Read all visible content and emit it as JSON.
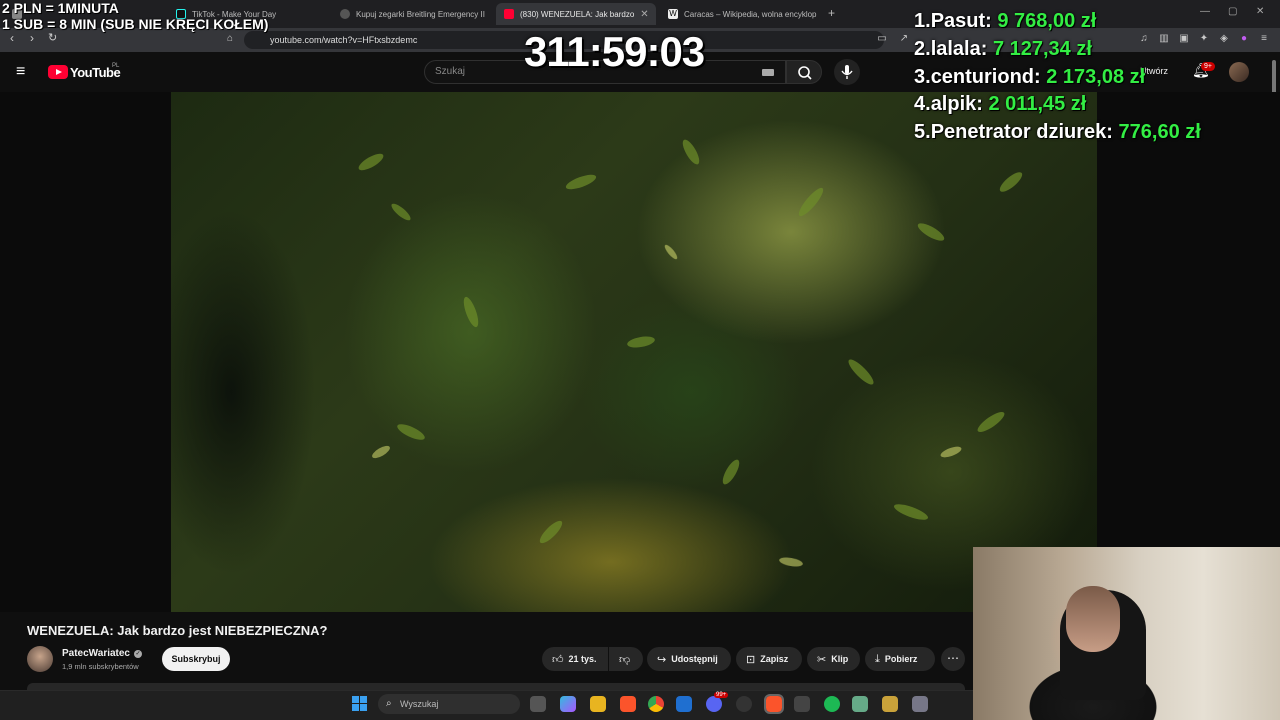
{
  "browser": {
    "tabs": [
      {
        "label": "",
        "icon": "tab-icon"
      },
      {
        "label": "TikTok - Make Your Day",
        "icon": "tiktok-icon"
      },
      {
        "label": "Kupuj zegarki Breitling Emergency II",
        "icon": "globe-icon"
      },
      {
        "label": "(830) WENEZUELA: Jak bardzo",
        "icon": "youtube-icon"
      },
      {
        "label": "Caracas – Wikipedia, wolna encyklop",
        "icon": "wikipedia-icon"
      }
    ],
    "new_tab_label": "+",
    "url": "youtube.com/watch?v=HFtxsbzdemc",
    "colors": {
      "tabbar": "#1f1f22",
      "toolbar": "#35363a"
    }
  },
  "youtube": {
    "logo_text": "YouTube",
    "region": "PL",
    "search_placeholder": "Szukaj",
    "create_label": "Utwórz",
    "notifications_badge": "9+",
    "brand_color": "#ff0033"
  },
  "video": {
    "title": "WENEZUELA: Jak bardzo jest NIEBEZPIECZNA?",
    "channel_name": "PatecWariatec",
    "channel_subs": "1,9 mln subskrybentów",
    "subscribe_label": "Subskrybuj",
    "likes": "21 tys.",
    "share_label": "Udostępnij",
    "save_label": "Zapisz",
    "clip_label": "Klip",
    "download_label": "Pobierz"
  },
  "overlay": {
    "donation_rule_1": "2 PLN =  1MINUTA",
    "donation_rule_2": "1 SUB = 8 MIN (SUB NIE KRĘCI KOŁEM)",
    "timer": "311:59:03",
    "leaderboard": [
      {
        "rank": "1.",
        "name": "Pasut:",
        "amount": "9 768,00 zł"
      },
      {
        "rank": "2.",
        "name": "lalala:",
        "amount": "7 127,34 zł"
      },
      {
        "rank": "3.",
        "name": "centuriond:",
        "amount": "2 173,08 zł"
      },
      {
        "rank": "4.",
        "name": "alpik:",
        "amount": "2 011,45 zł"
      },
      {
        "rank": "5.",
        "name": "Penetrator dziurek:",
        "amount": "776,60 zł"
      }
    ],
    "amount_color": "#33ee44"
  },
  "taskbar": {
    "search_placeholder": "Wyszukaj",
    "badge": "99+"
  }
}
